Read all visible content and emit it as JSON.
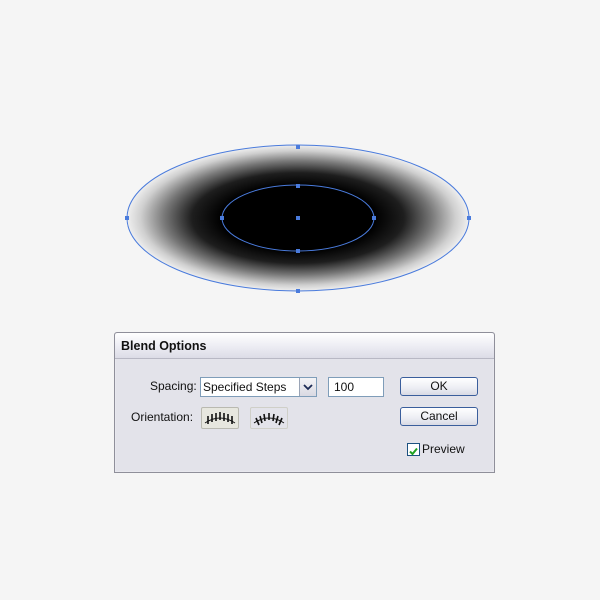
{
  "dialog": {
    "title": "Blend Options",
    "spacing_label": "Spacing:",
    "spacing_value": "Specified Steps",
    "steps_value": "100",
    "orientation_label": "Orientation:",
    "ok_label": "OK",
    "cancel_label": "Cancel",
    "preview_label": "Preview",
    "preview_checked": true
  },
  "icons": {
    "spacing_dropdown": "chevron-down-icon",
    "orient_align_page": "align-to-page-icon",
    "orient_align_path": "align-to-path-icon",
    "preview_check": "checkmark-icon"
  },
  "colors": {
    "selection": "#4a7bdc",
    "blend_inner": "#000000",
    "blend_outer": "#f2f2f2"
  }
}
